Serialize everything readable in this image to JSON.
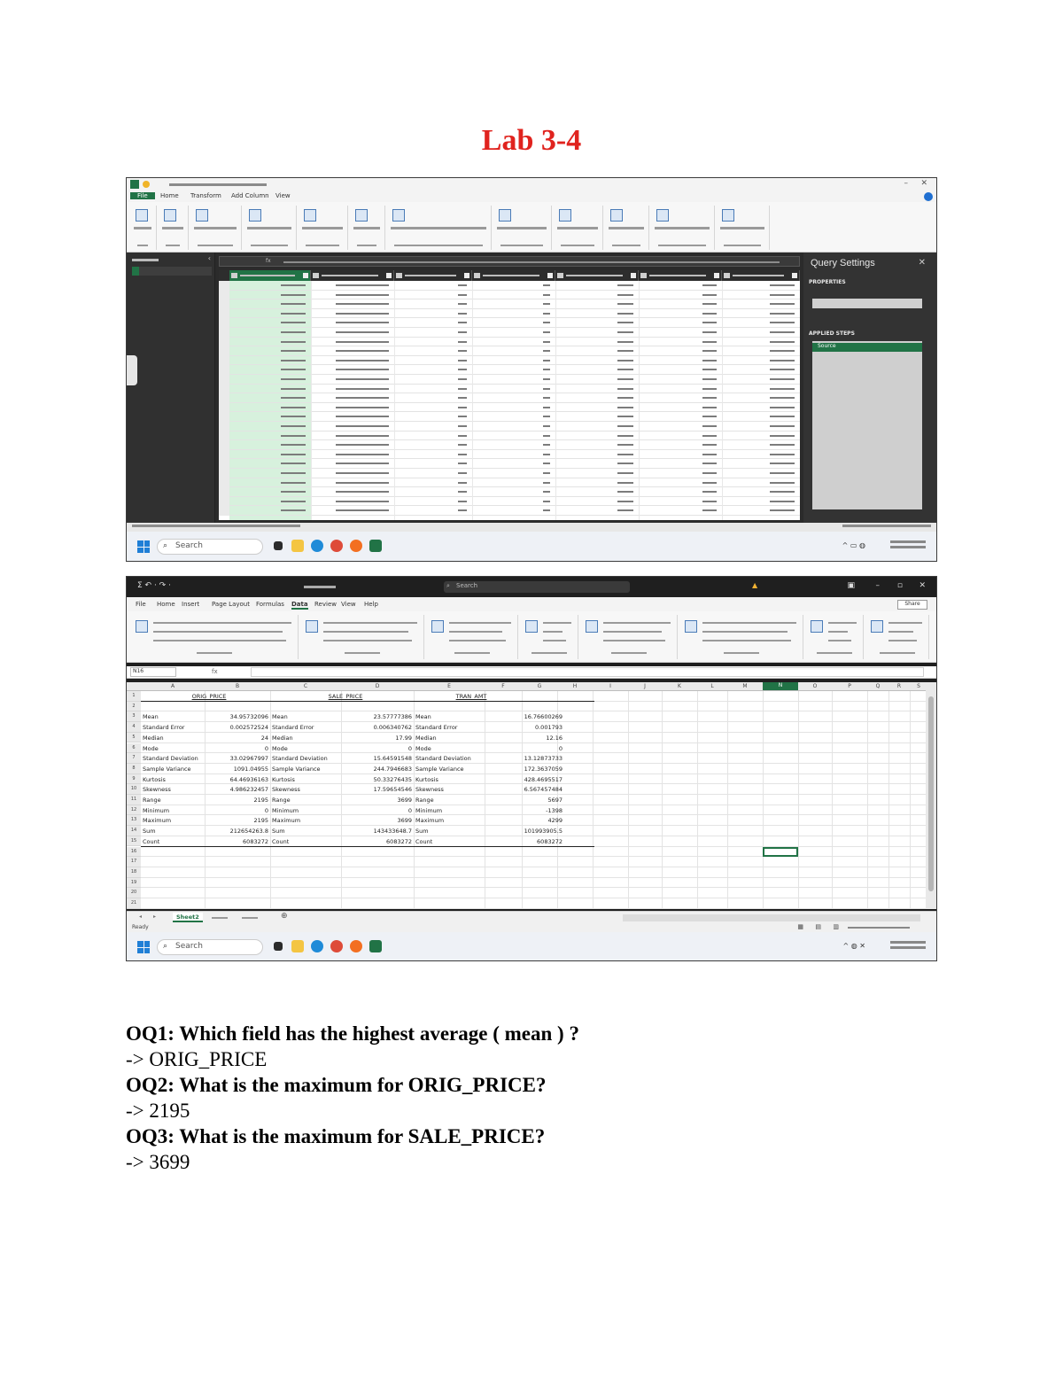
{
  "document": {
    "title": "Lab 3-4",
    "questions": [
      {
        "question": "OQ1: Which field has the highest average ( mean ) ?",
        "answer": "->  ORIG_PRICE"
      },
      {
        "question": "OQ2: What is the maximum for ORIG_PRICE?",
        "answer": "-> 2195"
      },
      {
        "question": "OQ3: What is the maximum for SALE_PRICE?",
        "answer": "-> 3699"
      }
    ]
  },
  "powerquery": {
    "tabs": [
      "File",
      "Home",
      "Transform",
      "Add Column",
      "View"
    ],
    "active_tab": "Home",
    "query_settings_title": "Query Settings",
    "properties_heading": "PROPERTIES",
    "applied_steps_heading": "APPLIED STEPS",
    "step_source": "Source",
    "search_placeholder": "Search"
  },
  "excel": {
    "tabs": [
      "File",
      "Home",
      "Insert",
      "Page Layout",
      "Formulas",
      "Data",
      "Review",
      "View",
      "Help"
    ],
    "active_tab": "Data",
    "share_label": "Share",
    "search_label": "Search",
    "name_box": "N16",
    "active_sheet": "Sheet2",
    "status": "Ready",
    "search_placeholder": "Search",
    "column_letters": [
      "A",
      "B",
      "C",
      "D",
      "E",
      "F",
      "G",
      "H",
      "I",
      "J",
      "K",
      "L",
      "M",
      "N",
      "O",
      "P",
      "Q",
      "R",
      "S"
    ],
    "headers": [
      "ORIG_PRICE",
      "SALE_PRICE",
      "TRAN_AMT"
    ],
    "stats_labels": [
      "Mean",
      "Standard Error",
      "Median",
      "Mode",
      "Standard Deviation",
      "Sample Variance",
      "Kurtosis",
      "Skewness",
      "Range",
      "Minimum",
      "Maximum",
      "Sum",
      "Count"
    ],
    "orig_values": [
      "34.95732096",
      "0.002572524",
      "24",
      "0",
      "33.02967997",
      "1091.04955",
      "64.46936163",
      "4.986232457",
      "2195",
      "0",
      "2195",
      "212654263.8",
      "6083272"
    ],
    "sale_values": [
      "23.57777386",
      "0.006340762",
      "17.99",
      "0",
      "15.64591548",
      "244.7946683",
      "50.33276435",
      "17.59654546",
      "3699",
      "0",
      "3699",
      "143433648.7",
      "6083272"
    ],
    "tran_values": [
      "16.76600269",
      "0.001793",
      "12.16",
      "0",
      "13.12873733",
      "172.3637059",
      "428.4695517",
      "6.567457484",
      "5697",
      "-1398",
      "4299",
      "101993905.5",
      "6083272"
    ]
  }
}
